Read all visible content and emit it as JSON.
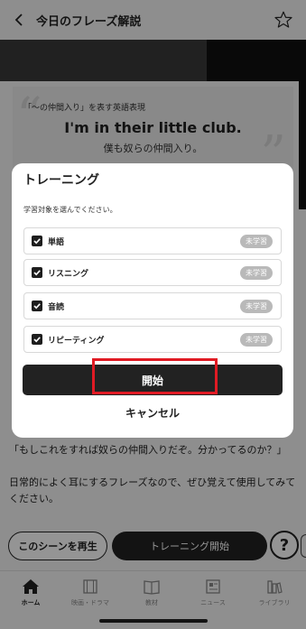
{
  "header": {
    "title": "今日のフレーズ解説",
    "back_icon": "chevron-left-icon",
    "favorite_icon": "star-outline-icon"
  },
  "phrase": {
    "tag": "「〜の仲間入り」を表す英語表現",
    "english": "I'm in their little club.",
    "japanese": "僕も奴らの仲間入り。"
  },
  "explanation": {
    "line1": "「もしこれをすれば奴らの仲間入りだぞ。分かってるのか？」",
    "line2": "日常的によく耳にするフレーズなので、ぜひ覚えて使用してみてください。"
  },
  "actions": {
    "play_scene": "このシーンを再生",
    "start_training": "トレーニング開始",
    "help": "?"
  },
  "tabs": [
    {
      "label": "ホーム",
      "icon": "home-icon",
      "active": true
    },
    {
      "label": "映画・ドラマ",
      "icon": "film-icon",
      "active": false
    },
    {
      "label": "教材",
      "icon": "book-icon",
      "active": false
    },
    {
      "label": "ニュース",
      "icon": "news-icon",
      "active": false
    },
    {
      "label": "ライブラリ",
      "icon": "library-icon",
      "active": false
    }
  ],
  "modal": {
    "title": "トレーニング",
    "subtitle": "学習対象を選んでください。",
    "options": [
      {
        "label": "単語",
        "status": "未学習",
        "checked": true
      },
      {
        "label": "リスニング",
        "status": "未学習",
        "checked": true
      },
      {
        "label": "音読",
        "status": "未学習",
        "checked": true
      },
      {
        "label": "リピーティング",
        "status": "未学習",
        "checked": true
      }
    ],
    "start": "開始",
    "cancel": "キャンセル"
  },
  "colors": {
    "accent_dark": "#222222",
    "highlight": "#e01b24",
    "badge": "#b9b9b9"
  }
}
